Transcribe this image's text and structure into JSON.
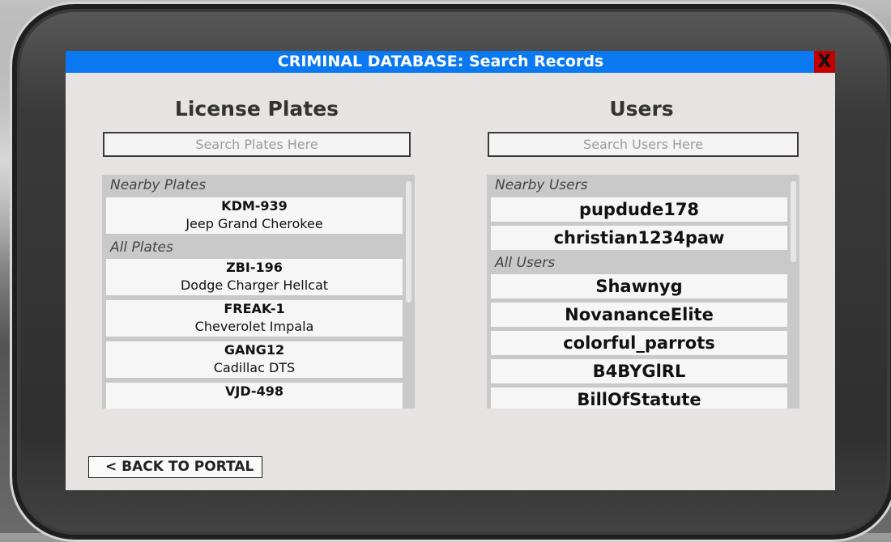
{
  "window": {
    "title": "CRIMINAL DATABASE: Search Records",
    "close_label": "X"
  },
  "plates": {
    "heading": "License Plates",
    "search_placeholder": "Search Plates Here",
    "nearby_label": "Nearby Plates",
    "all_label": "All Plates",
    "nearby": [
      {
        "plate": "KDM-939",
        "car": "Jeep Grand Cherokee"
      }
    ],
    "all": [
      {
        "plate": "ZBI-196",
        "car": "Dodge Charger Hellcat"
      },
      {
        "plate": "FREAK-1",
        "car": "Cheverolet Impala"
      },
      {
        "plate": "GANG12",
        "car": "Cadillac DTS"
      },
      {
        "plate": "VJD-498",
        "car": ""
      }
    ]
  },
  "users": {
    "heading": "Users",
    "search_placeholder": "Search Users Here",
    "nearby_label": "Nearby Users",
    "all_label": "All Users",
    "nearby": [
      "pupdude178",
      "christian1234paw"
    ],
    "all": [
      "Shawnyg",
      "NovananceElite",
      "colorful_parrots",
      "B4BYGlRL",
      "BillOfStatute"
    ]
  },
  "footer": {
    "back_label": "< BACK TO PORTAL"
  }
}
